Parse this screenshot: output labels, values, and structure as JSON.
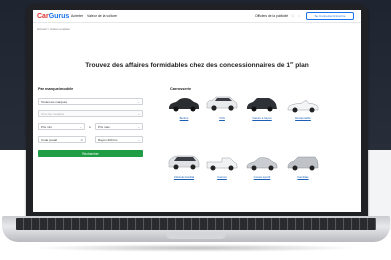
{
  "header": {
    "logo_main": "Car",
    "logo_accent": "Gurus",
    "nav": [
      "Acheter",
      "Valeur de la voiture"
    ],
    "right_link": "Officiers de la publicité",
    "connect_button": "Se Connecter/s'inscrire"
  },
  "breadcrumb": "Accueil  >  Autres emplois",
  "title_main": "Trouvez des affaires formidables chez des concessionnaires de 1",
  "title_sup": "er",
  "title_tail": " plan",
  "search": {
    "heading": "Par marque/modèle",
    "make_placeholder": "Toutes les marques",
    "model_placeholder": "Tous les modèles",
    "price_min": "Prix min.",
    "price_max": "Prix max.",
    "to_label": "à",
    "postal_code": "Code postal",
    "radius": "Rayon  200 km",
    "button": "Rechercher"
  },
  "body_types": {
    "heading": "Carrosserie",
    "items": [
      {
        "label": "Berline",
        "color": "#2b2d30"
      },
      {
        "label": "VUS",
        "color": "#e9eaec"
      },
      {
        "label": "Voiture à hayon",
        "color": "#2e3136"
      },
      {
        "label": "Décapotable",
        "color": "#f3f4f5"
      },
      {
        "label": "Véhicule familial",
        "color": "#dfe1e4"
      },
      {
        "label": "Camion",
        "color": "#f1f2f3"
      },
      {
        "label": "Coupé sportif",
        "color": "#c9ccd1"
      },
      {
        "label": "Familiale",
        "color": "#bfc3c8"
      }
    ]
  },
  "colors": {
    "brand_red": "#e2332f",
    "brand_blue": "#1a73e8",
    "search_green": "#1f9d45"
  }
}
